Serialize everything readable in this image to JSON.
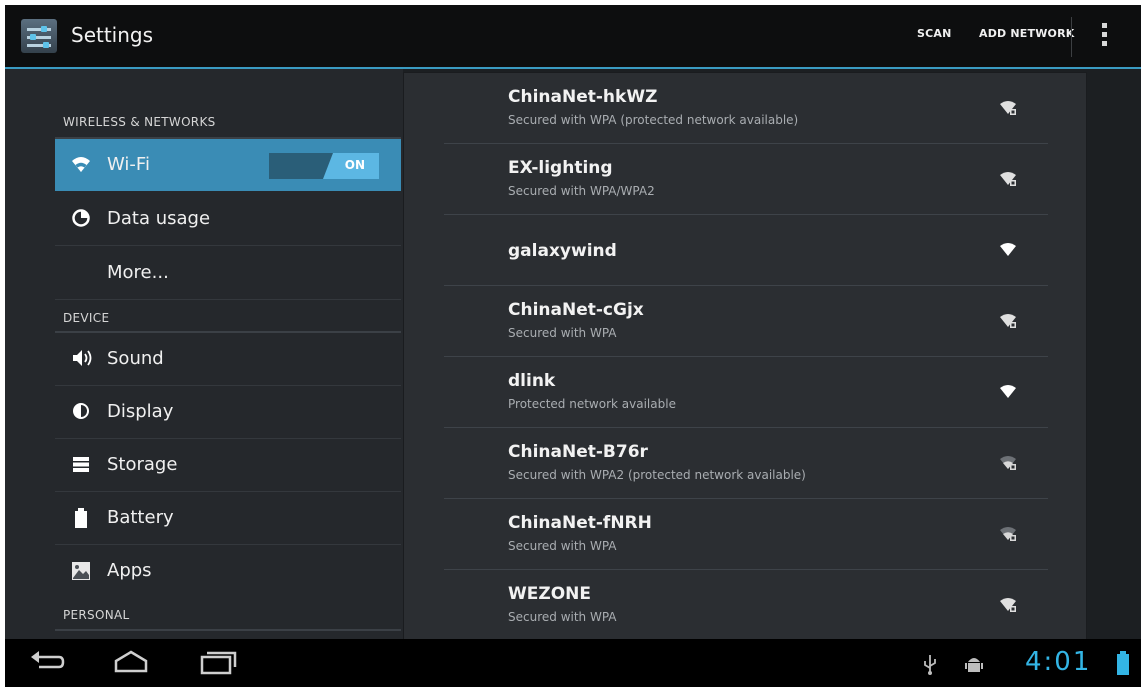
{
  "action_bar": {
    "title": "Settings",
    "scan_label": "SCAN",
    "add_network_label": "ADD NETWORK",
    "accent_color": "#3a9bc2"
  },
  "left_pane": {
    "sections": [
      {
        "header": "WIRELESS & NETWORKS"
      },
      {
        "header": "DEVICE"
      },
      {
        "header": "PERSONAL"
      }
    ],
    "items": [
      {
        "label": "Wi-Fi",
        "icon": "wifi-icon",
        "selected": true
      },
      {
        "label": "Data usage",
        "icon": "data-usage-icon"
      },
      {
        "label": "More...",
        "icon": ""
      },
      {
        "label": "Sound",
        "icon": "speaker-icon"
      },
      {
        "label": "Display",
        "icon": "brightness-icon"
      },
      {
        "label": "Storage",
        "icon": "storage-icon"
      },
      {
        "label": "Battery",
        "icon": "battery-icon"
      },
      {
        "label": "Apps",
        "icon": "apps-icon"
      }
    ],
    "wifi_toggle": {
      "label": "ON",
      "state": true
    }
  },
  "networks": [
    {
      "name": "ChinaNet-hkWZ",
      "subtitle": "Secured with WPA (protected network available)",
      "secured": true
    },
    {
      "name": "EX-lighting",
      "subtitle": "Secured with WPA/WPA2",
      "secured": true
    },
    {
      "name": "galaxywind",
      "subtitle": "",
      "secured": false
    },
    {
      "name": "ChinaNet-cGjx",
      "subtitle": "Secured with WPA",
      "secured": true
    },
    {
      "name": "dlink",
      "subtitle": "Protected network available",
      "secured": false
    },
    {
      "name": "ChinaNet-B76r",
      "subtitle": "Secured with WPA2 (protected network available)",
      "secured": true
    },
    {
      "name": "ChinaNet-fNRH",
      "subtitle": "Secured with WPA",
      "secured": true
    },
    {
      "name": "WEZONE",
      "subtitle": "Secured with WPA",
      "secured": true
    }
  ],
  "status_bar": {
    "clock": "4:01",
    "clock_color": "#33b5e5"
  }
}
